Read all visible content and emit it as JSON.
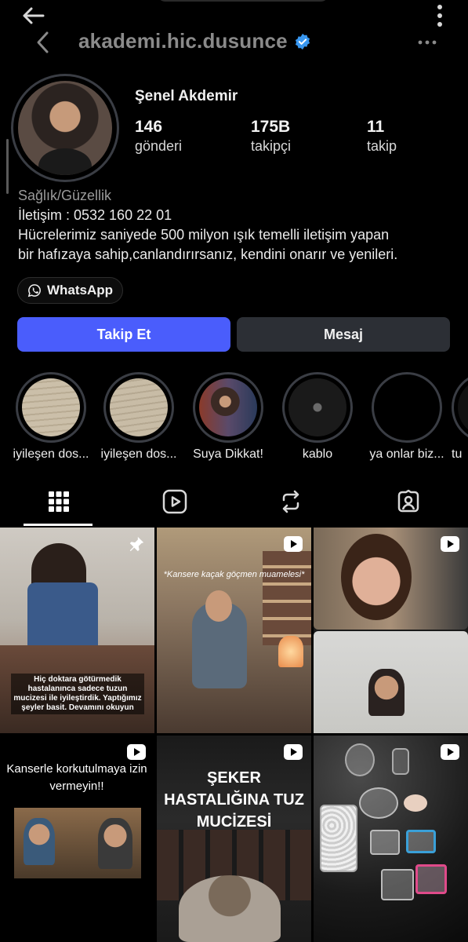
{
  "header": {
    "username": "akademi.hic.dusunce"
  },
  "profile": {
    "display_name": "Şenel Akdemir",
    "stats": [
      {
        "value": "146",
        "label": "gönderi"
      },
      {
        "value": "175B",
        "label": "takipçi"
      },
      {
        "value": "11",
        "label": "takip"
      }
    ],
    "category": "Sağlık/Güzellik",
    "bio_lines": [
      "İletişim : 0532 160 22 01",
      "Hücrelerimiz saniyede 500 milyon ışık temelli iletişim yapan",
      "bir hafızaya sahip,canlandırırsanız, kendini onarır ve yenileri."
    ],
    "whatsapp_label": "WhatsApp"
  },
  "actions": {
    "follow_label": "Takip Et",
    "message_label": "Mesaj"
  },
  "highlights": [
    {
      "label": "iyileşen dos..."
    },
    {
      "label": "iyileşen dos..."
    },
    {
      "label": "Suya Dikkat!"
    },
    {
      "label": "kablo"
    },
    {
      "label": "ya onlar biz..."
    },
    {
      "label": "tu"
    }
  ],
  "tabs": [
    "grid-icon",
    "reels-icon",
    "reposts-icon",
    "tagged-icon"
  ],
  "posts": {
    "p1_caption": "Hiç doktara götürmedik hastalanınca sadece tuzun mucizesi ile iyileştirdik. Yaptığımız şeyler basit. Devamını okuyun",
    "p2_caption": "*Kansere kaçak göçmen muamelesi*",
    "p4_caption": "Kanserle korkutulmaya izin vermeyin!!",
    "p5_caption": "ŞEKER HASTALIĞINA TUZ MUCİZESİ"
  },
  "colors": {
    "follow_button": "#4a5dfc",
    "message_button": "#2c2f35",
    "background": "#000000",
    "verified": "#3897f0"
  }
}
